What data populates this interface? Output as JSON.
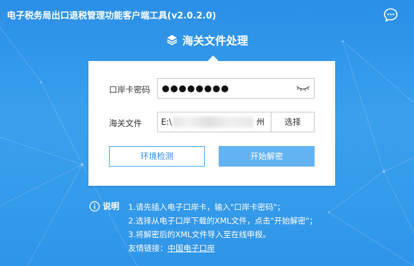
{
  "app": {
    "title": "电子税务局出口退税管理功能客户端工具(v2.0.2.0)"
  },
  "header": {
    "title": "海关文件处理",
    "icon": "layers-icon"
  },
  "form": {
    "card_password_label": "口岸卡密码",
    "card_password_value": "●●●●●●●●",
    "customs_file_label": "海关文件",
    "customs_file_value": "E:\\",
    "customs_file_tail": "州",
    "browse_label": "选择"
  },
  "buttons": {
    "env_check": "环境检测",
    "start_decrypt": "开始解密"
  },
  "notes": {
    "heading": "说明",
    "line1": "1.请先插入电子口岸卡，输入\"口岸卡密码\"；",
    "line2": "2.选择从电子口岸下载的XML文件，点击\"开始解密\"；",
    "line3": "3.将解密后的XML文件导入至在线申报。",
    "link_prefix": "友情链接：",
    "link_text": "中国电子口岸"
  },
  "colors": {
    "background": "#2f93e6",
    "accent": "#2a8ae0",
    "primary_button": "#63b3f3"
  }
}
